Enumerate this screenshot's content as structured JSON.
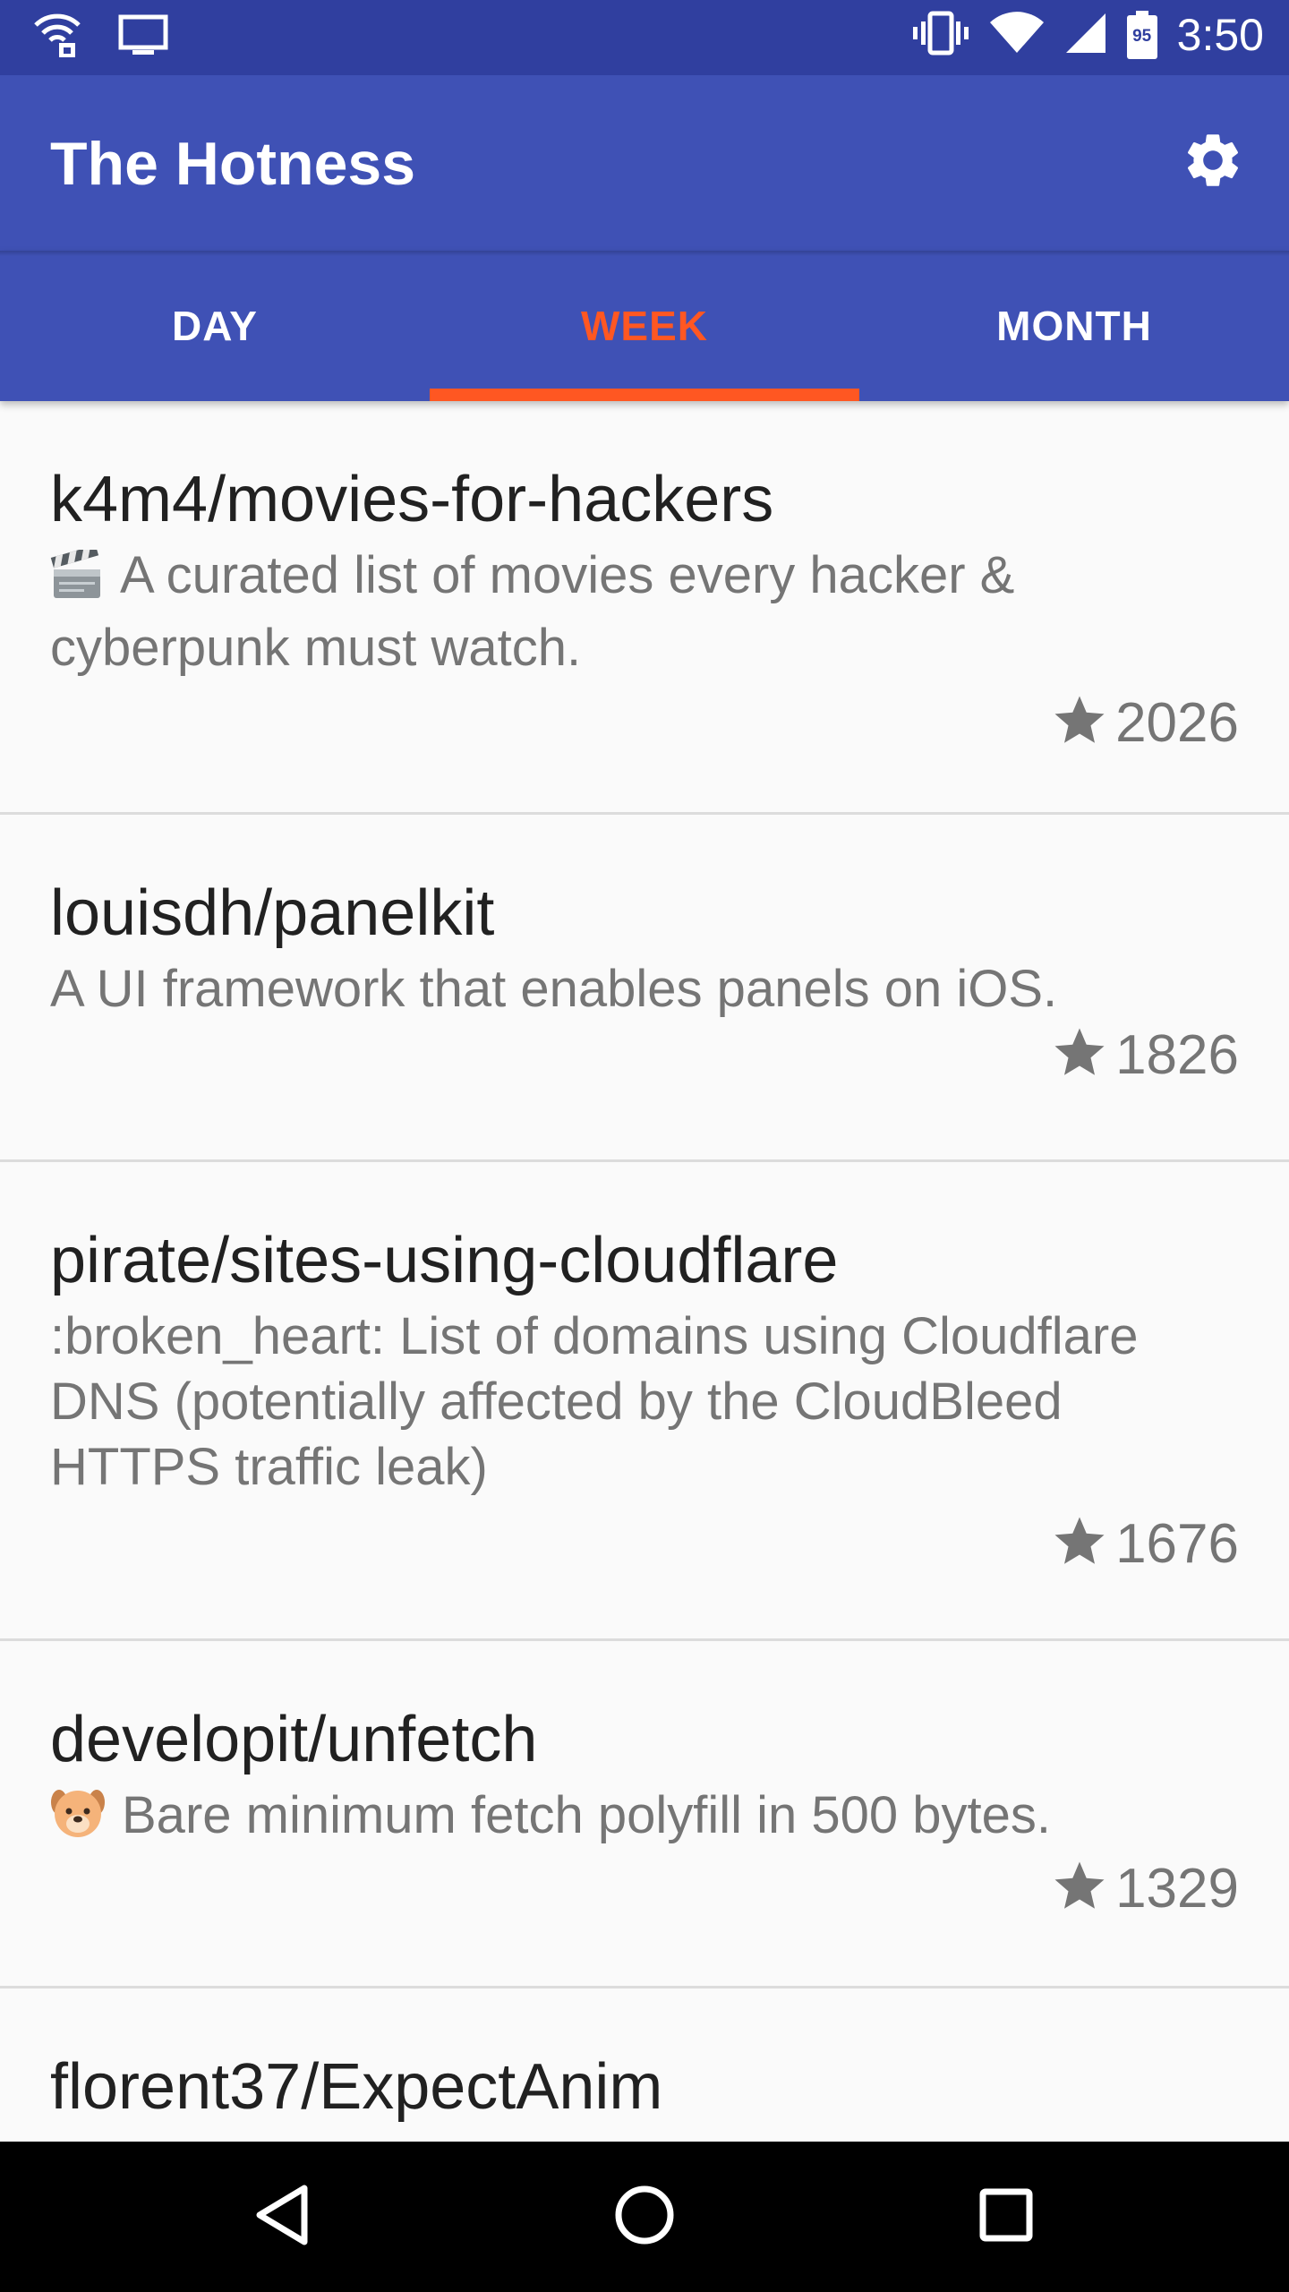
{
  "status_bar": {
    "time": "3:50",
    "battery_level": "95",
    "icons": [
      "wifi-lock-icon",
      "cast-icon",
      "vibrate-icon",
      "wifi-icon",
      "signal-icon",
      "battery-icon"
    ]
  },
  "app_bar": {
    "title": "The Hotness",
    "settings_icon": "gear-icon"
  },
  "tabs": [
    {
      "label": "DAY",
      "active": false
    },
    {
      "label": "WEEK",
      "active": true
    },
    {
      "label": "MONTH",
      "active": false
    }
  ],
  "colors": {
    "primary": "#3f51b5",
    "primary_dark": "#303f9f",
    "accent": "#ff5722"
  },
  "repos": [
    {
      "name": "k4m4/movies-for-hackers",
      "emoji_icon": "clapper-board-icon",
      "description": "A curated list of movies every hacker & cyberpunk must watch.",
      "stars": "2026"
    },
    {
      "name": "louisdh/panelkit",
      "description": "A UI framework that enables panels on iOS.",
      "stars": "1826"
    },
    {
      "name": "pirate/sites-using-cloudflare",
      "description": ":broken_heart: List of domains using Cloudflare DNS (potentially affected by the CloudBleed HTTPS traffic leak)",
      "stars": "1676"
    },
    {
      "name": "developit/unfetch",
      "emoji_icon": "dog-face-icon",
      "description": "Bare minimum fetch polyfill in 500 bytes.",
      "stars": "1329"
    },
    {
      "name": "florent37/ExpectAnim"
    }
  ],
  "nav_bar": {
    "back_icon": "back-icon",
    "home_icon": "home-icon",
    "recents_icon": "recents-icon"
  }
}
